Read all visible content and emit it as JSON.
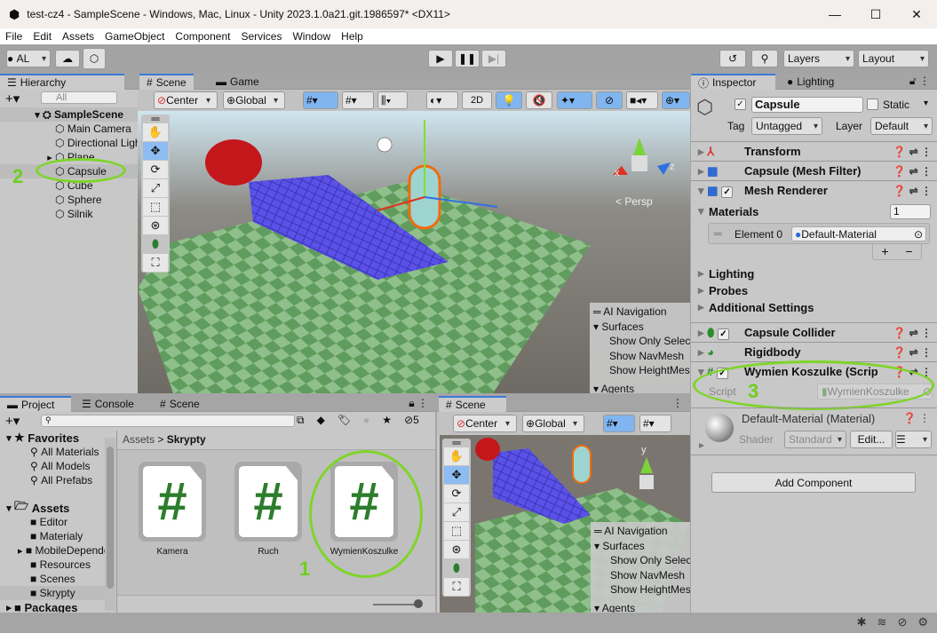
{
  "window": {
    "title": "test-cz4 - SampleScene - Windows, Mac, Linux - Unity 2023.1.0a21.git.1986597* <DX11>",
    "minimize": "—",
    "maximize": "☐",
    "close": "✕"
  },
  "menu": [
    "File",
    "Edit",
    "Assets",
    "GameObject",
    "Component",
    "Services",
    "Window",
    "Help"
  ],
  "toolbar": {
    "account": "AL",
    "layers": "Layers",
    "layout": "Layout"
  },
  "hierarchy": {
    "tab": "Hierarchy",
    "search_placeholder": "All",
    "scene": "SampleScene",
    "items": [
      "Main Camera",
      "Directional Light",
      "Plane",
      "Capsule",
      "Cube",
      "Sphere",
      "Silnik"
    ],
    "selected": "Capsule"
  },
  "scene": {
    "tabs": [
      "Scene",
      "Game"
    ],
    "pivot": "Center",
    "space": "Global",
    "mode2d": "2D",
    "persp": "< Persp",
    "axis_x": "x",
    "axis_y": "y",
    "axis_z": "z"
  },
  "ai_nav": {
    "title": "AI Navigation",
    "surfaces": "Surfaces",
    "items": [
      "Show Only Selected",
      "Show NavMesh",
      "Show HeightMesh"
    ],
    "agents": "Agents"
  },
  "inspector": {
    "tabs": [
      "Inspector",
      "Lighting"
    ],
    "object_name": "Capsule",
    "static_label": "Static",
    "tag_label": "Tag",
    "tag": "Untagged",
    "layer_label": "Layer",
    "layer": "Default",
    "components": [
      "Transform",
      "Capsule (Mesh Filter)",
      "Mesh Renderer"
    ],
    "materials_label": "Materials",
    "materials_count": "1",
    "element_label": "Element 0",
    "element_value": "Default-Material",
    "sections": [
      "Lighting",
      "Probes",
      "Additional Settings"
    ],
    "components2": [
      "Capsule Collider",
      "Rigidbody",
      "Wymien Koszulke (Script)"
    ],
    "script_label": "Script",
    "script_value": "WymienKoszulke",
    "material_name": "Default-Material (Material)",
    "shader_label": "Shader",
    "shader": "Standard",
    "edit": "Edit...",
    "add_component": "Add Component"
  },
  "project": {
    "tabs": [
      "Project",
      "Console",
      "Scene"
    ],
    "hidden_count": "5",
    "favorites": "Favorites",
    "fav_items": [
      "All Materials",
      "All Models",
      "All Prefabs"
    ],
    "assets": "Assets",
    "folders": [
      "Editor",
      "Materialy",
      "MobileDependencies",
      "Resources",
      "Scenes",
      "Skrypty"
    ],
    "packages": "Packages",
    "breadcrumb": [
      "Assets",
      "Skrypty"
    ],
    "files": [
      "Kamera",
      "Ruch",
      "WymienKoszulke"
    ],
    "file_glyph": "#"
  },
  "annotations": [
    "1",
    "2",
    "3"
  ],
  "colors": {
    "accent": "#3a79d8",
    "annotation": "#7fd42a",
    "script": "#2c7d2c"
  }
}
